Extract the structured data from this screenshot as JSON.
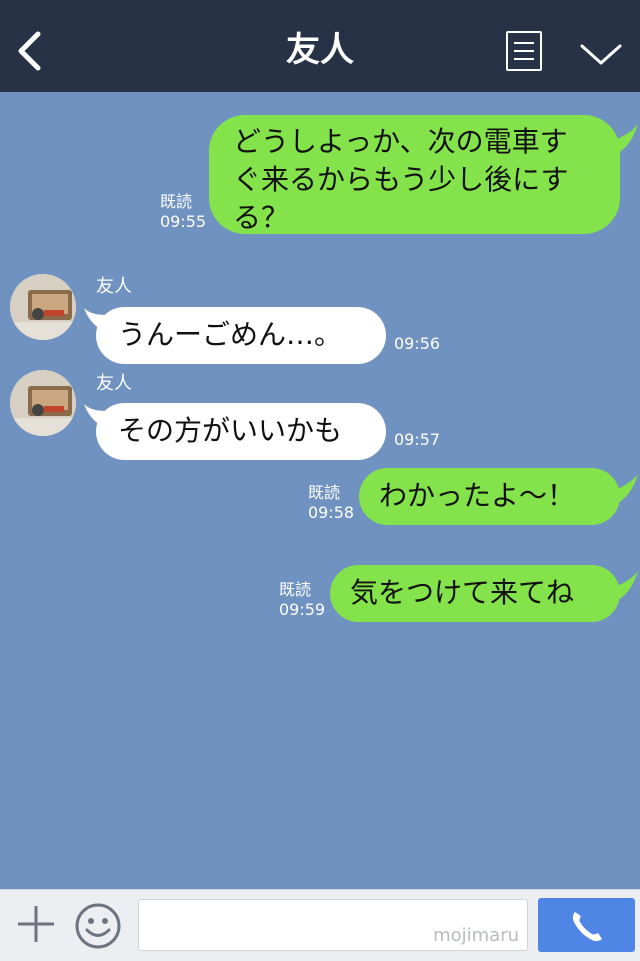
{
  "header": {
    "title": "友人"
  },
  "messages": [
    {
      "side": "mine",
      "lines": [
        "どうしよっか、次の電車す",
        "ぐ来るからもう少し後にす",
        "る？"
      ],
      "read": "既読",
      "time": "09:55"
    },
    {
      "side": "theirs",
      "sender": "友人",
      "text": "うんーごめん…。",
      "time": "09:56"
    },
    {
      "side": "theirs",
      "sender": "友人",
      "text": "その方がいいかも",
      "time": "09:57"
    },
    {
      "side": "mine",
      "text": "わかったよ〜！",
      "read": "既読",
      "time": "09:58"
    },
    {
      "side": "mine",
      "text": "気をつけて来てね",
      "read": "既読",
      "time": "09:59"
    }
  ],
  "footer": {
    "watermark": "mojimaru"
  },
  "colors": {
    "header_bg": "#273246",
    "chat_bg": "#7092c0",
    "mine_bubble": "#84e24a",
    "theirs_bubble": "#ffffff",
    "call_button": "#4f86e6"
  },
  "icons": [
    "back-chevron-icon",
    "menu-list-icon",
    "chevron-down-icon",
    "plus-icon",
    "emoji-icon",
    "phone-icon"
  ]
}
